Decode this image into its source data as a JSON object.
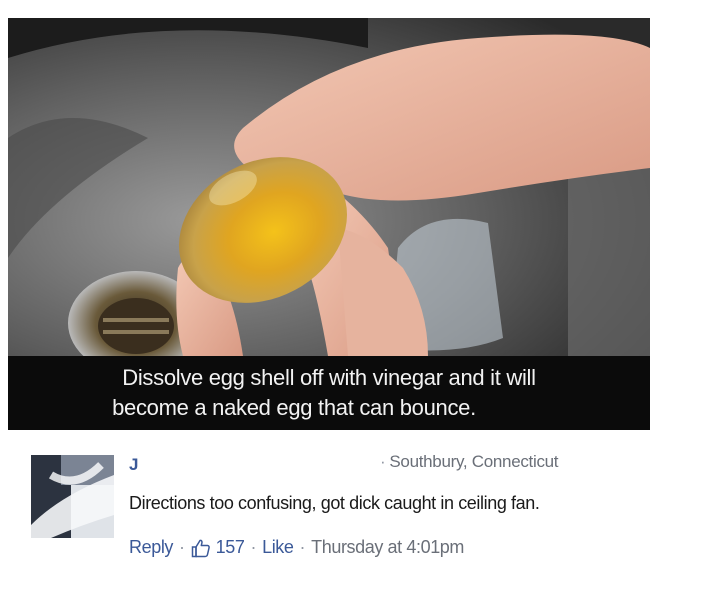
{
  "post": {
    "caption_line1": "Dissolve egg shell off with vinegar and it will",
    "caption_line2": "become a naked egg that can bounce."
  },
  "comment": {
    "author": "J",
    "location": "Southbury, Connecticut",
    "text": "Directions too confusing, got dick caught in ceiling fan.",
    "reply_label": "Reply",
    "like_count": "157",
    "like_label": "Like",
    "timestamp": "Thursday at 4:01pm"
  },
  "icons": {
    "like": "thumbs-up-icon",
    "avatar": "avatar-blurred"
  },
  "colors": {
    "link": "#3b5998",
    "meta": "#6a6f78",
    "caption_bg": "#0b0b0b"
  }
}
